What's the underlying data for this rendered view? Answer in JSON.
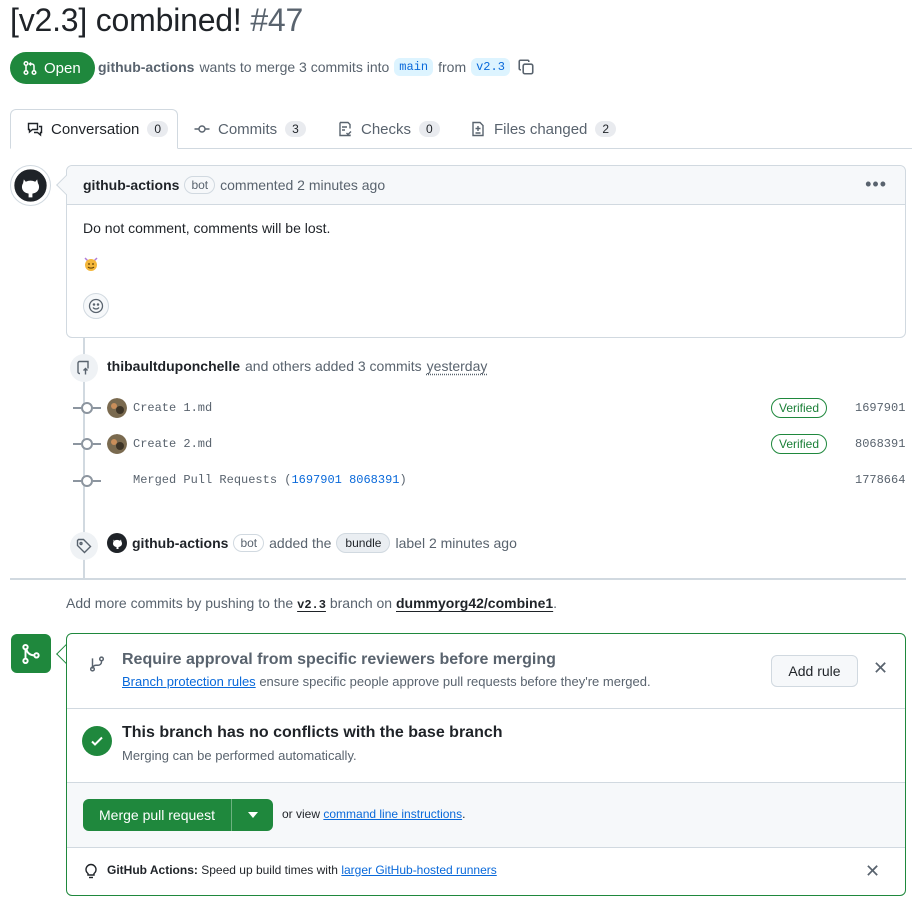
{
  "pr": {
    "title": "[v2.3] combined!",
    "number": "#47",
    "state": "Open",
    "author": "github-actions",
    "merge_text": "wants to merge 3 commits into",
    "base_branch": "main",
    "from_text": "from",
    "head_branch": "v2.3"
  },
  "tabs": [
    {
      "label": "Conversation",
      "count": "0"
    },
    {
      "label": "Commits",
      "count": "3"
    },
    {
      "label": "Checks",
      "count": "0"
    },
    {
      "label": "Files changed",
      "count": "2"
    }
  ],
  "comment": {
    "author": "github-actions",
    "badge": "bot",
    "time": "commented 2 minutes ago",
    "body": "Do not comment, comments will be lost."
  },
  "commits_event": {
    "author": "thibaultduponchelle",
    "text": "and others added 3 commits",
    "time": "yesterday"
  },
  "commits": [
    {
      "message": "Create 1.md",
      "verified": "Verified",
      "sha": "1697901"
    },
    {
      "message": "Create 2.md",
      "verified": "Verified",
      "sha": "8068391"
    },
    {
      "message_prefix": "Merged Pull Requests (",
      "ref1": "1697901",
      "ref2": "8068391",
      "message_suffix": ")",
      "sha": "1778664"
    }
  ],
  "label_event": {
    "author": "github-actions",
    "badge": "bot",
    "text": "added the",
    "label": "bundle",
    "suffix": "label 2 minutes ago"
  },
  "push_hint": {
    "prefix": "Add more commits by pushing to the",
    "branch": "v2.3",
    "middle": "branch on",
    "repo": "dummyorg42/combine1",
    "suffix": "."
  },
  "merge": {
    "approval_title": "Require approval from specific reviewers before merging",
    "approval_link": "Branch protection rules",
    "approval_desc": "ensure specific people approve pull requests before they're merged.",
    "add_rule": "Add rule",
    "conflict_title": "This branch has no conflicts with the base branch",
    "conflict_desc": "Merging can be performed automatically.",
    "merge_button": "Merge pull request",
    "or_view": "or view",
    "cli_link": "command line instructions",
    "cli_suffix": ".",
    "actions_label": "GitHub Actions:",
    "actions_text": "Speed up build times with",
    "actions_link": "larger GitHub-hosted runners"
  },
  "colors": {
    "accent_green": "#1f883d",
    "link_blue": "#0969da",
    "muted": "#59636e"
  }
}
